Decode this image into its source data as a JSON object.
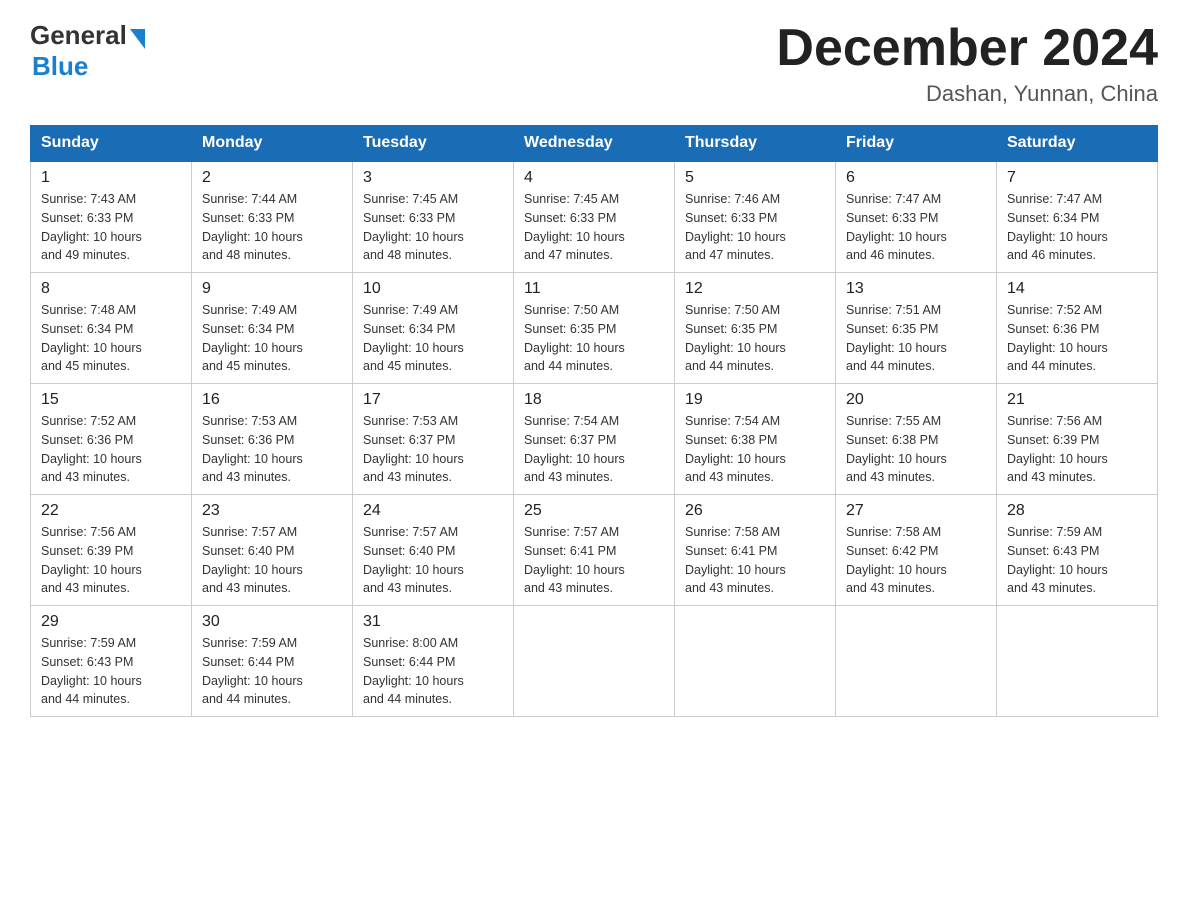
{
  "header": {
    "logo_general": "General",
    "logo_blue": "Blue",
    "title": "December 2024",
    "subtitle": "Dashan, Yunnan, China"
  },
  "days_header": [
    "Sunday",
    "Monday",
    "Tuesday",
    "Wednesday",
    "Thursday",
    "Friday",
    "Saturday"
  ],
  "weeks": [
    [
      {
        "day": "1",
        "sunrise": "7:43 AM",
        "sunset": "6:33 PM",
        "daylight": "10 hours and 49 minutes."
      },
      {
        "day": "2",
        "sunrise": "7:44 AM",
        "sunset": "6:33 PM",
        "daylight": "10 hours and 48 minutes."
      },
      {
        "day": "3",
        "sunrise": "7:45 AM",
        "sunset": "6:33 PM",
        "daylight": "10 hours and 48 minutes."
      },
      {
        "day": "4",
        "sunrise": "7:45 AM",
        "sunset": "6:33 PM",
        "daylight": "10 hours and 47 minutes."
      },
      {
        "day": "5",
        "sunrise": "7:46 AM",
        "sunset": "6:33 PM",
        "daylight": "10 hours and 47 minutes."
      },
      {
        "day": "6",
        "sunrise": "7:47 AM",
        "sunset": "6:33 PM",
        "daylight": "10 hours and 46 minutes."
      },
      {
        "day": "7",
        "sunrise": "7:47 AM",
        "sunset": "6:34 PM",
        "daylight": "10 hours and 46 minutes."
      }
    ],
    [
      {
        "day": "8",
        "sunrise": "7:48 AM",
        "sunset": "6:34 PM",
        "daylight": "10 hours and 45 minutes."
      },
      {
        "day": "9",
        "sunrise": "7:49 AM",
        "sunset": "6:34 PM",
        "daylight": "10 hours and 45 minutes."
      },
      {
        "day": "10",
        "sunrise": "7:49 AM",
        "sunset": "6:34 PM",
        "daylight": "10 hours and 45 minutes."
      },
      {
        "day": "11",
        "sunrise": "7:50 AM",
        "sunset": "6:35 PM",
        "daylight": "10 hours and 44 minutes."
      },
      {
        "day": "12",
        "sunrise": "7:50 AM",
        "sunset": "6:35 PM",
        "daylight": "10 hours and 44 minutes."
      },
      {
        "day": "13",
        "sunrise": "7:51 AM",
        "sunset": "6:35 PM",
        "daylight": "10 hours and 44 minutes."
      },
      {
        "day": "14",
        "sunrise": "7:52 AM",
        "sunset": "6:36 PM",
        "daylight": "10 hours and 44 minutes."
      }
    ],
    [
      {
        "day": "15",
        "sunrise": "7:52 AM",
        "sunset": "6:36 PM",
        "daylight": "10 hours and 43 minutes."
      },
      {
        "day": "16",
        "sunrise": "7:53 AM",
        "sunset": "6:36 PM",
        "daylight": "10 hours and 43 minutes."
      },
      {
        "day": "17",
        "sunrise": "7:53 AM",
        "sunset": "6:37 PM",
        "daylight": "10 hours and 43 minutes."
      },
      {
        "day": "18",
        "sunrise": "7:54 AM",
        "sunset": "6:37 PM",
        "daylight": "10 hours and 43 minutes."
      },
      {
        "day": "19",
        "sunrise": "7:54 AM",
        "sunset": "6:38 PM",
        "daylight": "10 hours and 43 minutes."
      },
      {
        "day": "20",
        "sunrise": "7:55 AM",
        "sunset": "6:38 PM",
        "daylight": "10 hours and 43 minutes."
      },
      {
        "day": "21",
        "sunrise": "7:56 AM",
        "sunset": "6:39 PM",
        "daylight": "10 hours and 43 minutes."
      }
    ],
    [
      {
        "day": "22",
        "sunrise": "7:56 AM",
        "sunset": "6:39 PM",
        "daylight": "10 hours and 43 minutes."
      },
      {
        "day": "23",
        "sunrise": "7:57 AM",
        "sunset": "6:40 PM",
        "daylight": "10 hours and 43 minutes."
      },
      {
        "day": "24",
        "sunrise": "7:57 AM",
        "sunset": "6:40 PM",
        "daylight": "10 hours and 43 minutes."
      },
      {
        "day": "25",
        "sunrise": "7:57 AM",
        "sunset": "6:41 PM",
        "daylight": "10 hours and 43 minutes."
      },
      {
        "day": "26",
        "sunrise": "7:58 AM",
        "sunset": "6:41 PM",
        "daylight": "10 hours and 43 minutes."
      },
      {
        "day": "27",
        "sunrise": "7:58 AM",
        "sunset": "6:42 PM",
        "daylight": "10 hours and 43 minutes."
      },
      {
        "day": "28",
        "sunrise": "7:59 AM",
        "sunset": "6:43 PM",
        "daylight": "10 hours and 43 minutes."
      }
    ],
    [
      {
        "day": "29",
        "sunrise": "7:59 AM",
        "sunset": "6:43 PM",
        "daylight": "10 hours and 44 minutes."
      },
      {
        "day": "30",
        "sunrise": "7:59 AM",
        "sunset": "6:44 PM",
        "daylight": "10 hours and 44 minutes."
      },
      {
        "day": "31",
        "sunrise": "8:00 AM",
        "sunset": "6:44 PM",
        "daylight": "10 hours and 44 minutes."
      },
      null,
      null,
      null,
      null
    ]
  ],
  "labels": {
    "sunrise": "Sunrise:",
    "sunset": "Sunset:",
    "daylight": "Daylight:"
  },
  "colors": {
    "header_bg": "#1a6db5",
    "header_text": "#ffffff",
    "border": "#cccccc"
  }
}
